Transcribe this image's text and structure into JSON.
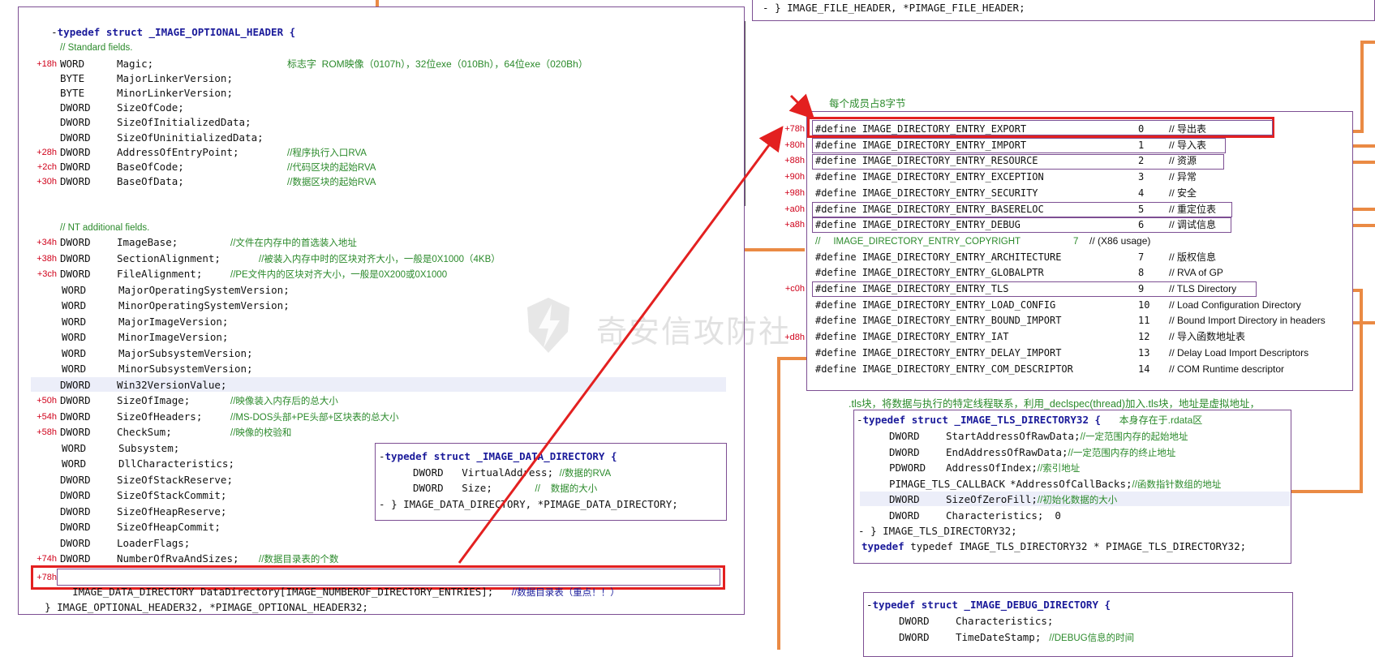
{
  "left": {
    "header": "typedef struct _IMAGE_OPTIONAL_HEADER {",
    "std_comment": "// Standard fields.",
    "std_lines": [
      {
        "off": "+18h",
        "type": "WORD",
        "name": "Magic;",
        "comment": "标志字  ROM映像（0107h），32位exe（010Bh），64位exe（020Bh）"
      },
      {
        "off": "",
        "type": "BYTE",
        "name": "MajorLinkerVersion;",
        "comment": ""
      },
      {
        "off": "",
        "type": "BYTE",
        "name": "MinorLinkerVersion;",
        "comment": ""
      },
      {
        "off": "",
        "type": "DWORD",
        "name": "SizeOfCode;",
        "comment": ""
      },
      {
        "off": "",
        "type": "DWORD",
        "name": "SizeOfInitializedData;",
        "comment": ""
      },
      {
        "off": "",
        "type": "DWORD",
        "name": "SizeOfUninitializedData;",
        "comment": ""
      },
      {
        "off": "+28h",
        "type": "DWORD",
        "name": "AddressOfEntryPoint;",
        "comment": "//程序执行入口RVA"
      },
      {
        "off": "+2ch",
        "type": "DWORD",
        "name": "BaseOfCode;",
        "comment": "//代码区块的起始RVA"
      },
      {
        "off": "+30h",
        "type": "DWORD",
        "name": "BaseOfData;",
        "comment": "//数据区块的起始RVA"
      }
    ],
    "nt_comment": "// NT additional fields.",
    "nt_lines": [
      {
        "off": "+34h",
        "type": "DWORD",
        "name": "ImageBase;",
        "comment": "//文件在内存中的首选装入地址"
      },
      {
        "off": "+38h",
        "type": "DWORD",
        "name": "SectionAlignment;",
        "comment": "//被装入内存中时的区块对齐大小，一般是0X1000（4KB）"
      },
      {
        "off": "+3ch",
        "type": "DWORD",
        "name": "FileAlignment;",
        "comment": "//PE文件内的区块对齐大小，一般是0X200或0X1000"
      },
      {
        "off": "",
        "type": "WORD",
        "name": "MajorOperatingSystemVersion;",
        "comment": ""
      },
      {
        "off": "",
        "type": "WORD",
        "name": "MinorOperatingSystemVersion;",
        "comment": ""
      },
      {
        "off": "",
        "type": "WORD",
        "name": "MajorImageVersion;",
        "comment": ""
      },
      {
        "off": "",
        "type": "WORD",
        "name": "MinorImageVersion;",
        "comment": ""
      },
      {
        "off": "",
        "type": "WORD",
        "name": "MajorSubsystemVersion;",
        "comment": ""
      },
      {
        "off": "",
        "type": "WORD",
        "name": "MinorSubsystemVersion;",
        "comment": ""
      },
      {
        "off": "",
        "type": "DWORD",
        "name": "Win32VersionValue;",
        "comment": ""
      },
      {
        "off": "+50h",
        "type": "DWORD",
        "name": "SizeOfImage;",
        "comment": "//映像装入内存后的总大小"
      },
      {
        "off": "+54h",
        "type": "DWORD",
        "name": "SizeOfHeaders;",
        "comment": "//MS-DOS头部+PE头部+区块表的总大小"
      },
      {
        "off": "+58h",
        "type": "DWORD",
        "name": "CheckSum;",
        "comment": "//映像的校验和"
      },
      {
        "off": "",
        "type": "WORD",
        "name": "Subsystem;",
        "comment": ""
      },
      {
        "off": "",
        "type": "WORD",
        "name": "DllCharacteristics;",
        "comment": ""
      },
      {
        "off": "",
        "type": "DWORD",
        "name": "SizeOfStackReserve;",
        "comment": ""
      },
      {
        "off": "",
        "type": "DWORD",
        "name": "SizeOfStackCommit;",
        "comment": ""
      },
      {
        "off": "",
        "type": "DWORD",
        "name": "SizeOfHeapReserve;",
        "comment": ""
      },
      {
        "off": "",
        "type": "DWORD",
        "name": "SizeOfHeapCommit;",
        "comment": ""
      },
      {
        "off": "",
        "type": "DWORD",
        "name": "LoaderFlags;",
        "comment": ""
      },
      {
        "off": "+74h",
        "type": "DWORD",
        "name": "NumberOfRvaAndSizes;",
        "comment": "//数据目录表的个数"
      }
    ],
    "dd_off": "+78h",
    "dd_line": "IMAGE_DATA_DIRECTORY DataDirectory[IMAGE_NUMBEROF_DIRECTORY_ENTRIES];",
    "dd_comment": "//数据目录表（重点！！）",
    "footer": "} IMAGE_OPTIONAL_HEADER32, *PIMAGE_OPTIONAL_HEADER32;"
  },
  "datadir": {
    "header": "typedef struct _IMAGE_DATA_DIRECTORY {",
    "l1_type": "DWORD",
    "l1_name": "VirtualAddress;",
    "l1_comment": "//数据的RVA",
    "l2_type": "DWORD",
    "l2_name": "Size;",
    "l2_comment": "//    数据的大小",
    "footer": "} IMAGE_DATA_DIRECTORY, *PIMAGE_DATA_DIRECTORY;"
  },
  "filehdr": {
    "footer": "} IMAGE_FILE_HEADER, *PIMAGE_FILE_HEADER;"
  },
  "directory": {
    "note": "每个成员占8字节",
    "entries": [
      {
        "off": "+78h",
        "name": "#define IMAGE_DIRECTORY_ENTRY_EXPORT",
        "num": "0",
        "comment": "// 导出表"
      },
      {
        "off": "+80h",
        "name": "#define IMAGE_DIRECTORY_ENTRY_IMPORT",
        "num": "1",
        "comment": "// 导入表"
      },
      {
        "off": "+88h",
        "name": "#define IMAGE_DIRECTORY_ENTRY_RESOURCE",
        "num": "2",
        "comment": "// 资源"
      },
      {
        "off": "+90h",
        "name": "#define IMAGE_DIRECTORY_ENTRY_EXCEPTION",
        "num": "3",
        "comment": "// 异常"
      },
      {
        "off": "+98h",
        "name": "#define IMAGE_DIRECTORY_ENTRY_SECURITY",
        "num": "4",
        "comment": "// 安全"
      },
      {
        "off": "+a0h",
        "name": "#define IMAGE_DIRECTORY_ENTRY_BASERELOC",
        "num": "5",
        "comment": "// 重定位表"
      },
      {
        "off": "+a8h",
        "name": "#define IMAGE_DIRECTORY_ENTRY_DEBUG",
        "num": "6",
        "comment": "// 调试信息"
      },
      {
        "off": "",
        "name": "//     IMAGE_DIRECTORY_ENTRY_COPYRIGHT",
        "num": "7",
        "comment": "// (X86 usage)"
      },
      {
        "off": "",
        "name": "#define IMAGE_DIRECTORY_ENTRY_ARCHITECTURE",
        "num": "7",
        "comment": "// 版权信息"
      },
      {
        "off": "",
        "name": "#define IMAGE_DIRECTORY_ENTRY_GLOBALPTR",
        "num": "8",
        "comment": "// RVA of GP"
      },
      {
        "off": "+c0h",
        "name": "#define IMAGE_DIRECTORY_ENTRY_TLS",
        "num": "9",
        "comment": "// TLS Directory"
      },
      {
        "off": "",
        "name": "#define IMAGE_DIRECTORY_ENTRY_LOAD_CONFIG",
        "num": "10",
        "comment": "// Load Configuration Directory"
      },
      {
        "off": "",
        "name": "#define IMAGE_DIRECTORY_ENTRY_BOUND_IMPORT",
        "num": "11",
        "comment": "// Bound Import Directory in headers"
      },
      {
        "off": "",
        "name": "#define IMAGE_DIRECTORY_ENTRY_IAT",
        "num": "12",
        "comment": "// 导入函数地址表"
      },
      {
        "off": "",
        "name": "#define IMAGE_DIRECTORY_ENTRY_DELAY_IMPORT",
        "num": "13",
        "comment": "// Delay Load Import Descriptors"
      },
      {
        "off": "",
        "name": "#define IMAGE_DIRECTORY_ENTRY_COM_DESCRIPTOR",
        "num": "14",
        "comment": "// COM Runtime descriptor"
      }
    ],
    "side_off": "+d8h"
  },
  "tls": {
    "note": ".tls块，将数据与执行的特定线程联系，利用_declspec(thread)加入.tls块，地址是虚拟地址，",
    "header": "typedef struct _IMAGE_TLS_DIRECTORY32 {",
    "header_note": "本身存在于.rdata区",
    "lines": [
      {
        "type": "DWORD",
        "name": "StartAddressOfRawData;",
        "comment": "//一定范围内存的起始地址"
      },
      {
        "type": "DWORD",
        "name": "EndAddressOfRawData;",
        "comment": "//一定范围内存的终止地址"
      },
      {
        "type": "PDWORD",
        "name": "AddressOfIndex;",
        "comment": "//索引地址"
      },
      {
        "type": "PIMAGE_TLS_CALLBACK",
        "name": "*AddressOfCallBacks;",
        "comment": "//函数指针数组的地址"
      },
      {
        "type": "DWORD",
        "name": "SizeOfZeroFill;",
        "comment": "//初始化数据的大小"
      },
      {
        "type": "DWORD",
        "name": "Characteristics;",
        "comment": "0"
      }
    ],
    "footer1": "} IMAGE_TLS_DIRECTORY32;",
    "footer2": "typedef IMAGE_TLS_DIRECTORY32 * PIMAGE_TLS_DIRECTORY32;"
  },
  "debug": {
    "header": "typedef struct _IMAGE_DEBUG_DIRECTORY {",
    "lines": [
      {
        "type": "DWORD",
        "name": "Characteristics;",
        "comment": ""
      },
      {
        "type": "DWORD",
        "name": "TimeDateStamp;",
        "comment": "//DEBUG信息的时间"
      }
    ]
  },
  "watermark": "奇安信攻防社",
  "colors": {
    "red": "#e32020",
    "orange": "#ea8a44",
    "purple": "#7d4f93",
    "green": "#2b8a2b",
    "keyword": "#1a1a9a"
  }
}
